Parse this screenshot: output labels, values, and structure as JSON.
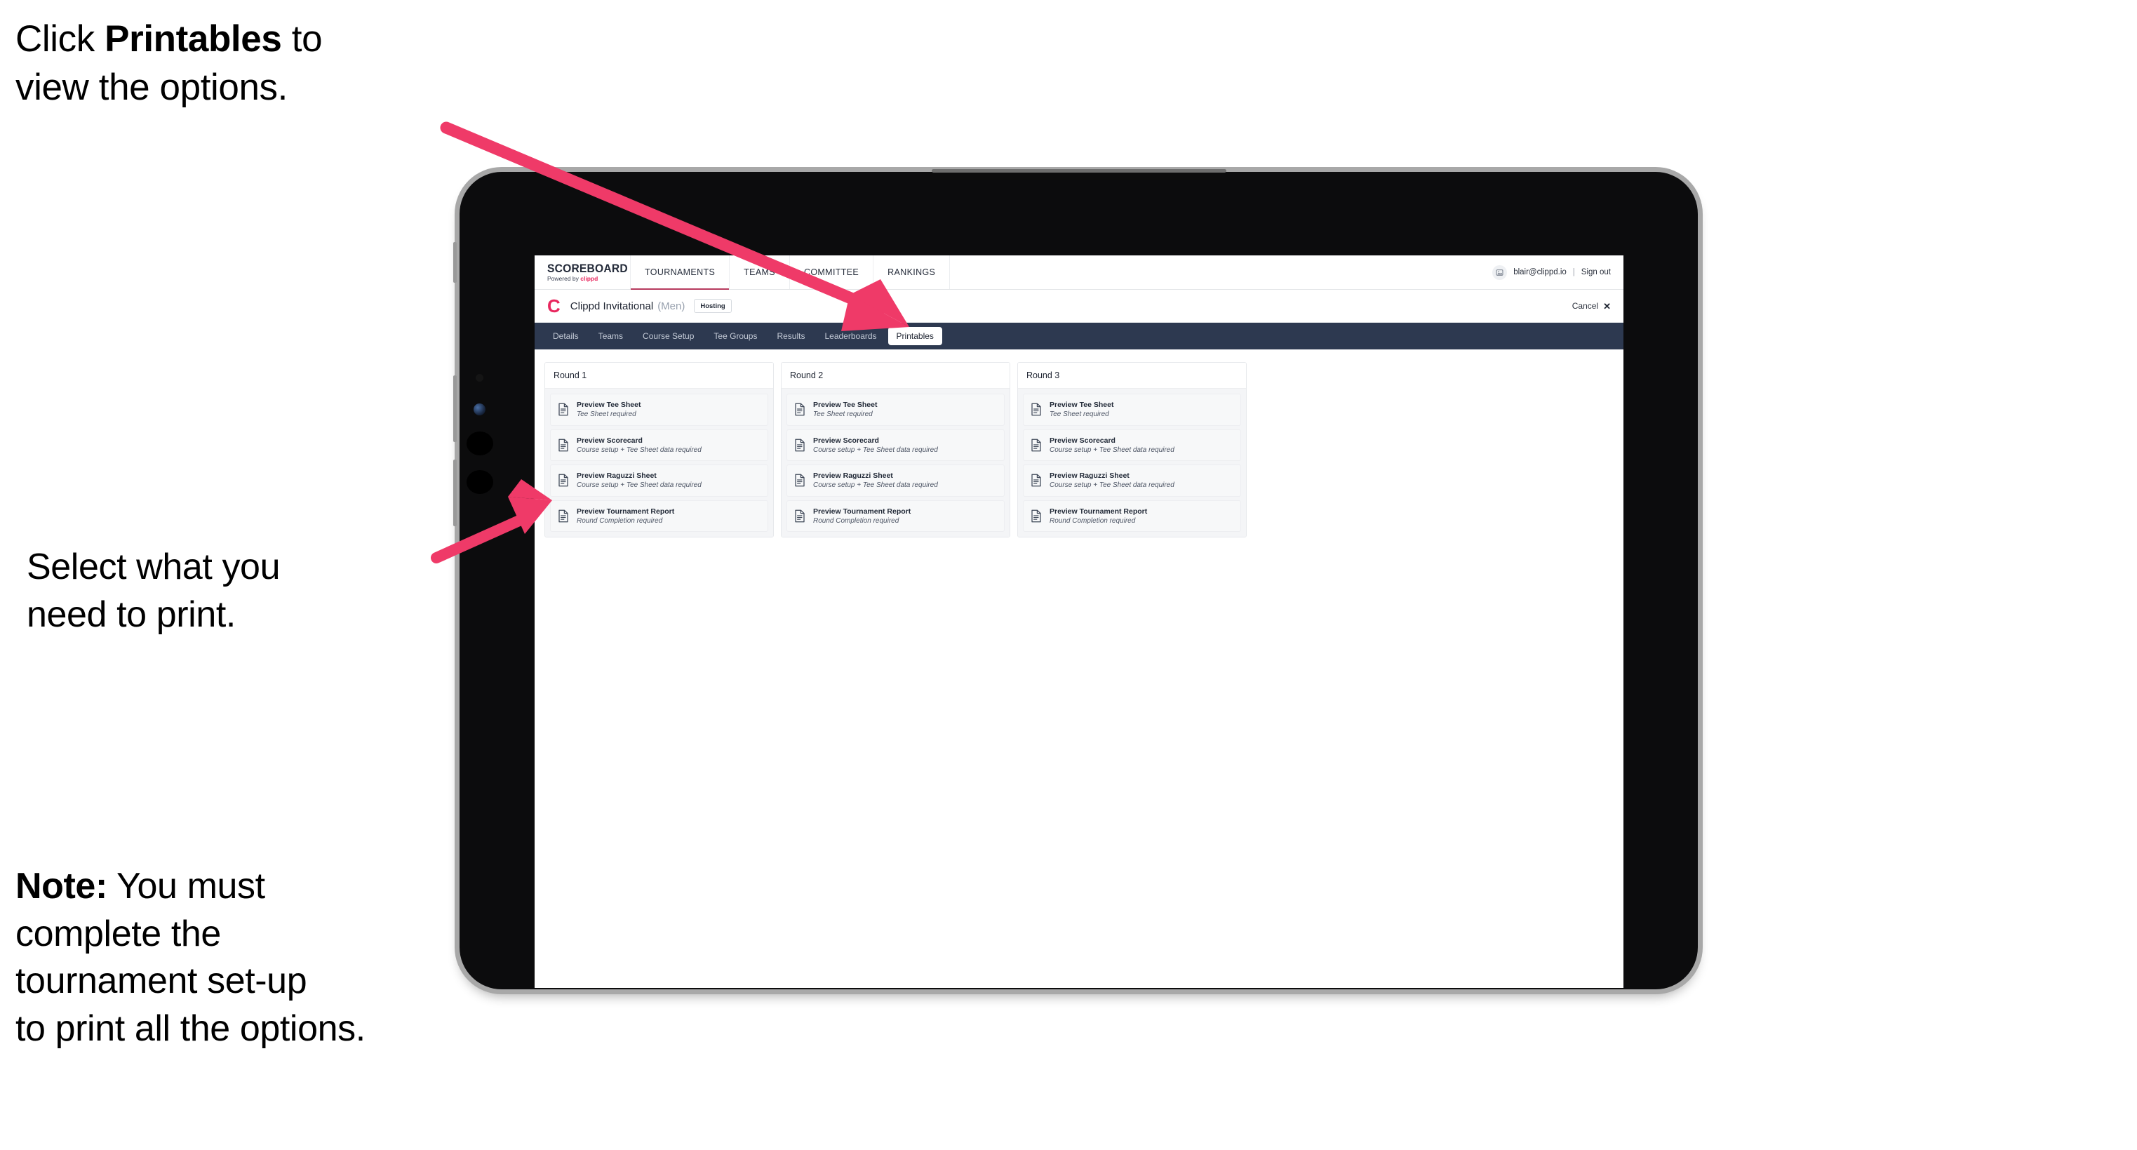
{
  "annotations": [
    {
      "id": "callout-1",
      "text_before": "Click ",
      "bold": "Printables",
      "text_after": " to\nview the options."
    },
    {
      "id": "callout-2",
      "text_before": "Select what you\n need to print.",
      "bold": "",
      "text_after": ""
    },
    {
      "id": "callout-3",
      "text_before": "",
      "bold": "Note:",
      "text_after": " You must\ncomplete the\ntournament set-up\nto print all the options."
    }
  ],
  "arrow_color": "#ef3a68",
  "app": {
    "logo": {
      "wordmark": "SCOREBOARD",
      "powered_by_prefix": "Powered by ",
      "powered_by_brand": "clippd"
    },
    "main_nav": [
      {
        "label": "TOURNAMENTS",
        "active": true
      },
      {
        "label": "TEAMS",
        "active": false
      },
      {
        "label": "COMMITTEE",
        "active": false
      },
      {
        "label": "RANKINGS",
        "active": false
      }
    ],
    "account": {
      "avatar_icon": "user-image-icon",
      "email": "blair@clippd.io",
      "separator": "|",
      "sign_out": "Sign out"
    },
    "subheader": {
      "brand_mark": "C",
      "tournament_name": "Clippd Invitational",
      "gender": "(Men)",
      "role_badge": "Hosting",
      "cancel_label": "Cancel",
      "cancel_icon": "close-x-icon"
    },
    "tabs": [
      {
        "label": "Details",
        "active": false
      },
      {
        "label": "Teams",
        "active": false
      },
      {
        "label": "Course Setup",
        "active": false
      },
      {
        "label": "Tee Groups",
        "active": false
      },
      {
        "label": "Results",
        "active": false
      },
      {
        "label": "Leaderboards",
        "active": false
      },
      {
        "label": "Printables",
        "active": true
      }
    ],
    "rounds": [
      {
        "title": "Round 1",
        "items": [
          {
            "icon": "document-icon",
            "title": "Preview Tee Sheet",
            "requirement": "Tee Sheet required"
          },
          {
            "icon": "document-icon",
            "title": "Preview Scorecard",
            "requirement": "Course setup + Tee Sheet data required"
          },
          {
            "icon": "document-icon",
            "title": "Preview Raguzzi Sheet",
            "requirement": "Course setup + Tee Sheet data required"
          },
          {
            "icon": "document-icon",
            "title": "Preview Tournament Report",
            "requirement": "Round Completion required"
          }
        ]
      },
      {
        "title": "Round 2",
        "items": [
          {
            "icon": "document-icon",
            "title": "Preview Tee Sheet",
            "requirement": "Tee Sheet required"
          },
          {
            "icon": "document-icon",
            "title": "Preview Scorecard",
            "requirement": "Course setup + Tee Sheet data required"
          },
          {
            "icon": "document-icon",
            "title": "Preview Raguzzi Sheet",
            "requirement": "Course setup + Tee Sheet data required"
          },
          {
            "icon": "document-icon",
            "title": "Preview Tournament Report",
            "requirement": "Round Completion required"
          }
        ]
      },
      {
        "title": "Round 3",
        "items": [
          {
            "icon": "document-icon",
            "title": "Preview Tee Sheet",
            "requirement": "Tee Sheet required"
          },
          {
            "icon": "document-icon",
            "title": "Preview Scorecard",
            "requirement": "Course setup + Tee Sheet data required"
          },
          {
            "icon": "document-icon",
            "title": "Preview Raguzzi Sheet",
            "requirement": "Course setup + Tee Sheet data required"
          },
          {
            "icon": "document-icon",
            "title": "Preview Tournament Report",
            "requirement": "Round Completion required"
          }
        ]
      }
    ],
    "colors": {
      "brand_pink": "#e8275e",
      "tabstrip_navy": "#2d3950",
      "active_nav_underline": "#b73a5e"
    }
  }
}
